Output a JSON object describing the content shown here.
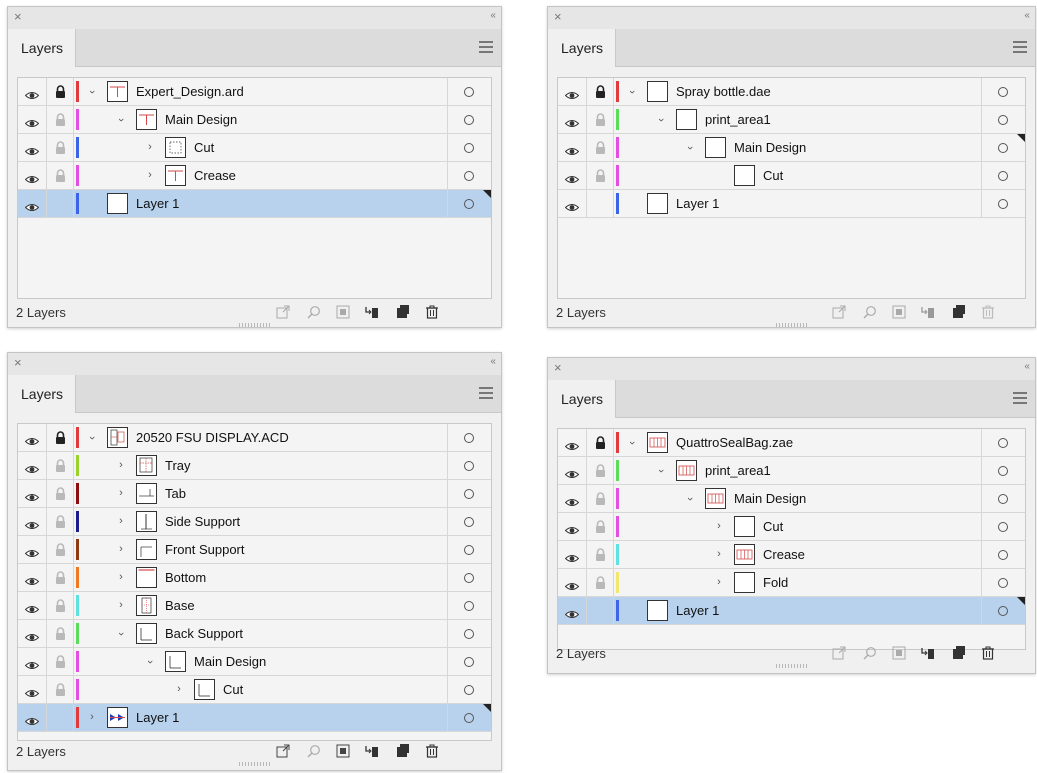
{
  "colors": {
    "red": "#e23b3b",
    "magenta": "#e24fe2",
    "blue": "#3c64e8",
    "green": "#5bdc5b",
    "lime": "#9bd22c",
    "darkred": "#8b0f0f",
    "navy": "#1c1c8c",
    "brown": "#8c3a12",
    "orange": "#ef7a22",
    "cyan": "#5ee1e1",
    "yellow": "#f2e870",
    "selected_row": "#b8d2ee"
  },
  "panels": [
    {
      "close_glyph": "×",
      "collapse_glyph": "‹‹",
      "tab_label": "Layers",
      "footer_label": "2 Layers",
      "rows": [
        {
          "label": "Expert_Design.ard",
          "lock": "dark",
          "color": "red",
          "indent": 0,
          "chevron": "down",
          "thumb": "design"
        },
        {
          "label": "Main Design",
          "lock": "light",
          "color": "magenta",
          "indent": 1,
          "chevron": "down",
          "thumb": "design"
        },
        {
          "label": "Cut",
          "lock": "light",
          "color": "blue",
          "indent": 2,
          "chevron": "right",
          "thumb": "cut"
        },
        {
          "label": "Crease",
          "lock": "light",
          "color": "magenta",
          "indent": 2,
          "chevron": "right",
          "thumb": "design"
        },
        {
          "label": "Layer 1",
          "lock": "none",
          "color": "blue",
          "indent": 0,
          "chevron": "none",
          "thumb": "blank",
          "selected": true
        }
      ]
    },
    {
      "close_glyph": "×",
      "collapse_glyph": "‹‹",
      "tab_label": "Layers",
      "footer_label": "2 Layers",
      "rows": [
        {
          "label": "Spray bottle.dae",
          "lock": "dark",
          "color": "red",
          "indent": 0,
          "chevron": "down",
          "thumb": "blank"
        },
        {
          "label": "print_area1",
          "lock": "light",
          "color": "green",
          "indent": 1,
          "chevron": "down",
          "thumb": "blank"
        },
        {
          "label": "Main Design",
          "lock": "light",
          "color": "magenta",
          "indent": 2,
          "chevron": "down",
          "thumb": "blank",
          "corner": true
        },
        {
          "label": "Cut",
          "lock": "light",
          "color": "magenta",
          "indent": 3,
          "chevron": "none",
          "thumb": "blank"
        },
        {
          "label": "Layer 1",
          "lock": "none",
          "color": "blue",
          "indent": 0,
          "chevron": "none",
          "thumb": "blank"
        }
      ]
    },
    {
      "close_glyph": "×",
      "collapse_glyph": "‹‹",
      "tab_label": "Layers",
      "footer_label": "2 Layers",
      "rows": [
        {
          "label": "20520 FSU DISPLAY.ACD",
          "lock": "dark",
          "color": "red",
          "indent": 0,
          "chevron": "down",
          "thumb": "display"
        },
        {
          "label": "Tray",
          "lock": "light",
          "color": "lime",
          "indent": 1,
          "chevron": "right",
          "thumb": "tray"
        },
        {
          "label": "Tab",
          "lock": "light",
          "color": "darkred",
          "indent": 1,
          "chevron": "right",
          "thumb": "tab"
        },
        {
          "label": "Side Support",
          "lock": "light",
          "color": "navy",
          "indent": 1,
          "chevron": "right",
          "thumb": "side"
        },
        {
          "label": "Front Support",
          "lock": "light",
          "color": "brown",
          "indent": 1,
          "chevron": "right",
          "thumb": "front"
        },
        {
          "label": "Bottom",
          "lock": "light",
          "color": "orange",
          "indent": 1,
          "chevron": "right",
          "thumb": "bottom"
        },
        {
          "label": "Base",
          "lock": "light",
          "color": "cyan",
          "indent": 1,
          "chevron": "right",
          "thumb": "base"
        },
        {
          "label": "Back Support",
          "lock": "light",
          "color": "green",
          "indent": 1,
          "chevron": "down",
          "thumb": "back"
        },
        {
          "label": "Main Design",
          "lock": "light",
          "color": "magenta",
          "indent": 2,
          "chevron": "down",
          "thumb": "back"
        },
        {
          "label": "Cut",
          "lock": "light",
          "color": "magenta",
          "indent": 3,
          "chevron": "right",
          "thumb": "back"
        },
        {
          "label": "Layer 1",
          "lock": "none",
          "color": "red",
          "indent": 0,
          "chevron": "right",
          "thumb": "arrows",
          "selected": true
        }
      ]
    },
    {
      "close_glyph": "×",
      "collapse_glyph": "‹‹",
      "tab_label": "Layers",
      "footer_label": "2 Layers",
      "rows": [
        {
          "label": "QuattroSealBag.zae",
          "lock": "dark",
          "color": "red",
          "indent": 0,
          "chevron": "down",
          "thumb": "bag"
        },
        {
          "label": "print_area1",
          "lock": "light",
          "color": "green",
          "indent": 1,
          "chevron": "down",
          "thumb": "bag"
        },
        {
          "label": "Main Design",
          "lock": "light",
          "color": "magenta",
          "indent": 2,
          "chevron": "down",
          "thumb": "bag"
        },
        {
          "label": "Cut",
          "lock": "light",
          "color": "magenta",
          "indent": 3,
          "chevron": "right",
          "thumb": "blank"
        },
        {
          "label": "Crease",
          "lock": "light",
          "color": "cyan",
          "indent": 3,
          "chevron": "right",
          "thumb": "bag"
        },
        {
          "label": "Fold",
          "lock": "light",
          "color": "yellow",
          "indent": 3,
          "chevron": "right",
          "thumb": "blank"
        },
        {
          "label": "Layer 1",
          "lock": "none",
          "color": "blue",
          "indent": 0,
          "chevron": "none",
          "thumb": "blank",
          "selected": true
        }
      ]
    }
  ]
}
